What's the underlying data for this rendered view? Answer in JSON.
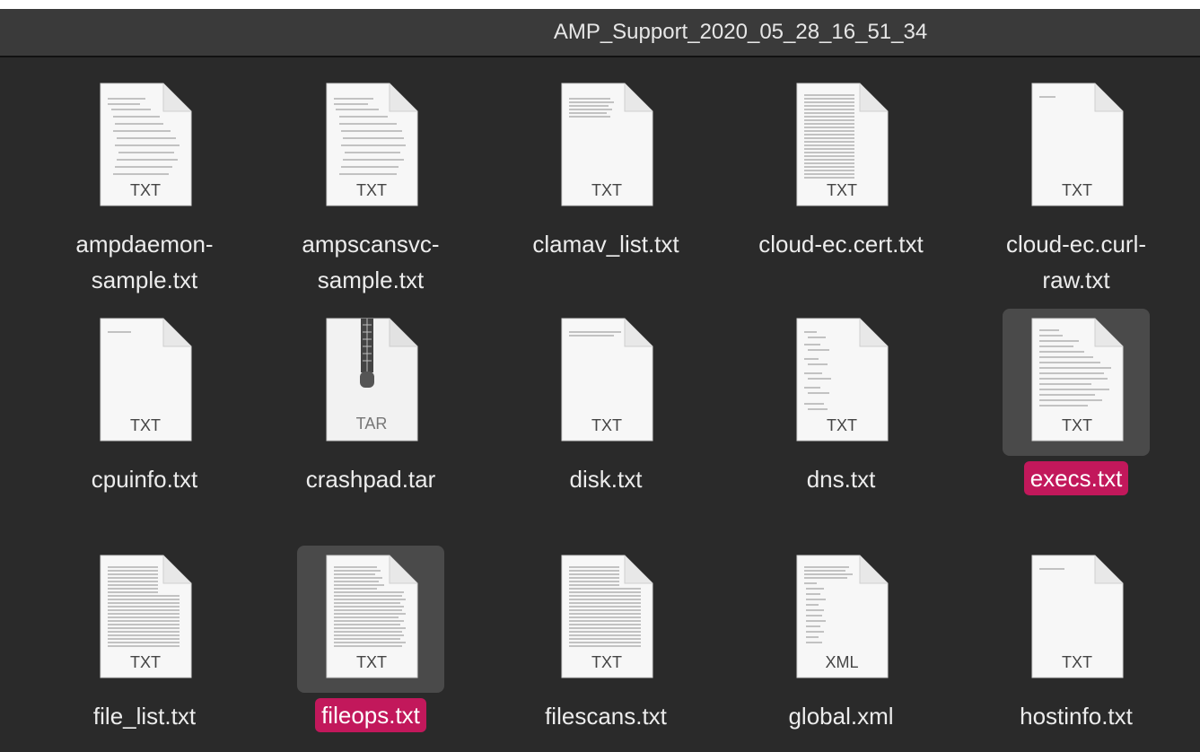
{
  "window": {
    "title": "AMP_Support_2020_05_28_16_51_34"
  },
  "files": [
    {
      "name": "ampdaemon-sample.txt",
      "ext": "TXT",
      "icon": "text-file-icon",
      "selected": false
    },
    {
      "name": "ampscansvc-sample.txt",
      "ext": "TXT",
      "icon": "text-file-icon",
      "selected": false
    },
    {
      "name": "clamav_list.txt",
      "ext": "TXT",
      "icon": "text-file-icon",
      "selected": false
    },
    {
      "name": "cloud-ec.cert.txt",
      "ext": "TXT",
      "icon": "text-file-icon",
      "selected": false
    },
    {
      "name": "cloud-ec.curl-raw.txt",
      "ext": "TXT",
      "icon": "text-file-icon",
      "selected": false
    },
    {
      "name": "cpuinfo.txt",
      "ext": "TXT",
      "icon": "text-file-icon",
      "selected": false
    },
    {
      "name": "crashpad.tar",
      "ext": "TAR",
      "icon": "archive-file-icon",
      "selected": false
    },
    {
      "name": "disk.txt",
      "ext": "TXT",
      "icon": "text-file-icon",
      "selected": false
    },
    {
      "name": "dns.txt",
      "ext": "TXT",
      "icon": "text-file-icon",
      "selected": false
    },
    {
      "name": "execs.txt",
      "ext": "TXT",
      "icon": "text-file-icon",
      "selected": true
    },
    {
      "name": "file_list.txt",
      "ext": "TXT",
      "icon": "text-file-icon",
      "selected": false
    },
    {
      "name": "fileops.txt",
      "ext": "TXT",
      "icon": "text-file-icon",
      "selected": true
    },
    {
      "name": "filescans.txt",
      "ext": "TXT",
      "icon": "text-file-icon",
      "selected": false
    },
    {
      "name": "global.xml",
      "ext": "XML",
      "icon": "xml-file-icon",
      "selected": false
    },
    {
      "name": "hostinfo.txt",
      "ext": "TXT",
      "icon": "text-file-icon",
      "selected": false
    }
  ],
  "colors": {
    "window_background": "#2a2a2a",
    "titlebar_background": "#3a3a3a",
    "selection_highlight": "#c2185b"
  }
}
